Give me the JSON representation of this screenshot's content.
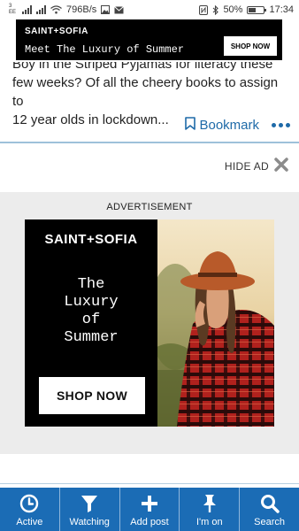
{
  "status_bar": {
    "carrier_top": "3",
    "carrier_bottom": "EE",
    "net_speed": "796B/s",
    "battery_percent": "50%",
    "battery_level": 0.5,
    "time": "17:34"
  },
  "top_banner": {
    "brand": "SAINT+SOFIA",
    "tagline": "Meet The Luxury of Summer",
    "cta": "SHOP NOW"
  },
  "article": {
    "cut_line": "Boy in the Striped Pyjamas for literacy these past",
    "line1": "few weeks? Of all the cheery books to assign to",
    "line2": "12 year olds in lockdown...",
    "bookmark_label": "Bookmark"
  },
  "hide_ad": {
    "label": "HIDE AD"
  },
  "ad": {
    "label": "ADVERTISEMENT",
    "brand": "SAINT+SOFIA",
    "headline": "The\nLuxury\nof\nSummer",
    "cta": "SHOP NOW"
  },
  "bottom_nav": {
    "items": [
      {
        "label": "Active",
        "icon": "clock-icon"
      },
      {
        "label": "Watching",
        "icon": "filter-icon"
      },
      {
        "label": "Add post",
        "icon": "plus-icon"
      },
      {
        "label": "I'm on",
        "icon": "pin-icon"
      },
      {
        "label": "Search",
        "icon": "search-icon"
      }
    ]
  },
  "colors": {
    "nav_background": "#1b6cb5",
    "link_blue": "#1e6aa8",
    "ad_background": "#ececec"
  }
}
